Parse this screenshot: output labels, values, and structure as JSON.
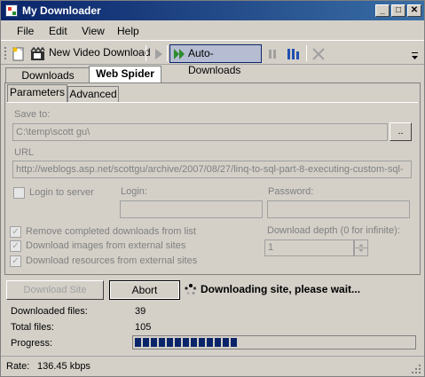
{
  "window": {
    "title": "My Downloader"
  },
  "menu": [
    "File",
    "Edit",
    "View",
    "Help"
  ],
  "toolbar": {
    "new_video_label": "New Video Download",
    "auto_downloads_label": "Auto-Downloads"
  },
  "tabs": {
    "downloads": "Downloads",
    "web_spider": "Web Spider"
  },
  "subtabs": {
    "parameters": "Parameters",
    "advanced": "Advanced"
  },
  "form": {
    "save_to_label": "Save to:",
    "save_to_value": "C:\\temp\\scott gu\\",
    "browse_label": "..",
    "url_label": "URL",
    "url_value": "http://weblogs.asp.net/scottgu/archive/2007/08/27/linq-to-sql-part-8-executing-custom-sql-",
    "login_to_server": "Login to server",
    "login_label": "Login:",
    "password_label": "Password:",
    "remove_completed": "Remove completed downloads from list",
    "download_images": "Download images from external sites",
    "download_resources": "Download resources from external sites",
    "depth_label": "Download depth (0 for infinite):",
    "depth_value": "1"
  },
  "actions": {
    "download_site": "Download Site",
    "abort": "Abort",
    "status_text": "Downloading site, please wait..."
  },
  "stats": {
    "downloaded_label": "Downloaded files:",
    "downloaded_value": "39",
    "total_label": "Total files:",
    "total_value": "105",
    "progress_label": "Progress:",
    "progress_fraction": 0.37
  },
  "statusbar": {
    "rate_label": "Rate:",
    "rate_value": "136.45 kbps"
  },
  "colors": {
    "titlebar": "#0a246a",
    "progress": "#0a246a",
    "face": "#d4d0c8"
  },
  "icons": [
    "app-icon",
    "new-video-icon",
    "play-icon",
    "auto-downloads-icon",
    "pause-icon",
    "columns-icon",
    "stop-icon",
    "spinner-icon"
  ]
}
